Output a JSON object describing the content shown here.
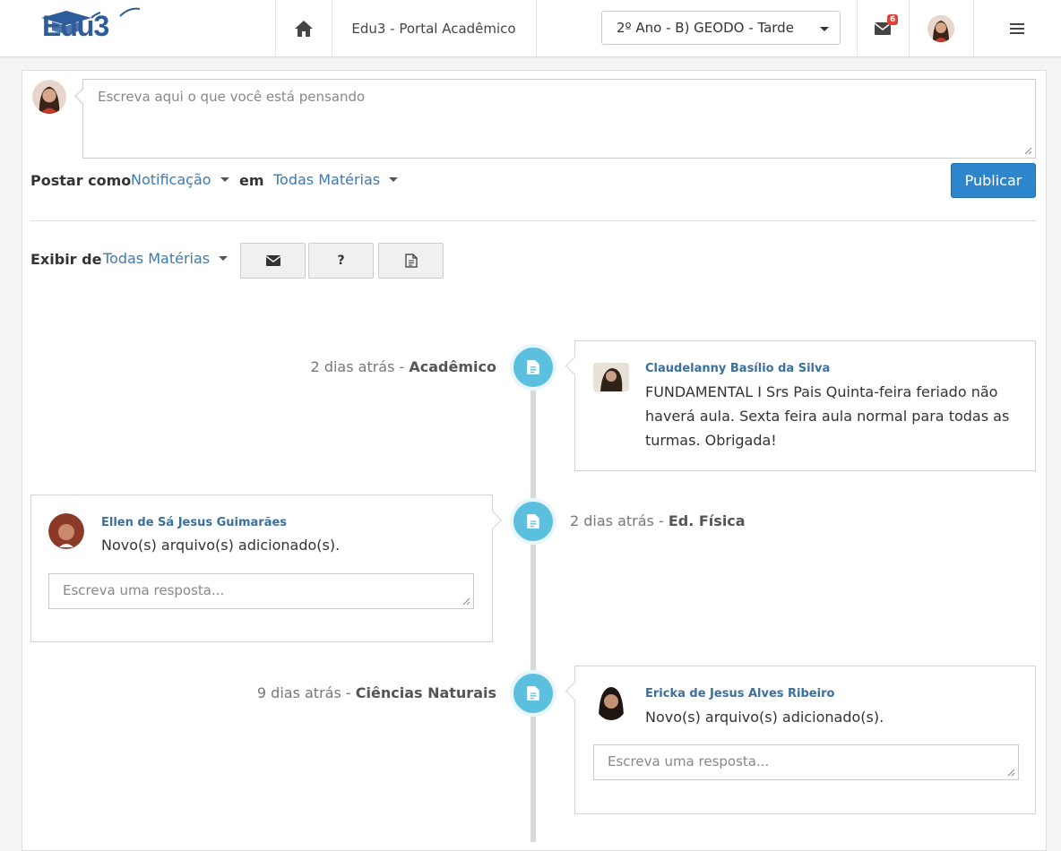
{
  "header": {
    "brand": "Edu3",
    "portal_title": "Edu3 - Portal Acadêmico",
    "class_selector": "2º Ano - B) GEODO - Tarde",
    "mail_badge": "6"
  },
  "composer": {
    "placeholder": "Escreva aqui o que você está pensando",
    "post_as_label": "Postar como",
    "post_as_value": "Notificação",
    "in_label": "em",
    "subject_value": "Todas Matérias",
    "publish_label": "Publicar"
  },
  "filters": {
    "show_label": "Exibir de",
    "show_value": "Todas Matérias",
    "buttons": [
      {
        "icon": "envelope-icon"
      },
      {
        "label": "?"
      },
      {
        "icon": "document-icon"
      }
    ]
  },
  "timeline": [
    {
      "time": "2 dias atrás - ",
      "subject": "Acadêmico",
      "author": "Claudelanny Basílio da Silva",
      "message": "FUNDAMENTAL I Srs Pais Quinta-feira feriado não haverá aula. Sexta feira aula normal para todas as turmas. Obrigada!"
    },
    {
      "time": "2 dias atrás - ",
      "subject": "Ed. Física",
      "author": "Ellen de Sá Jesus Guimarães",
      "message": "Novo(s) arquivo(s) adicionado(s).",
      "reply_placeholder": "Escreva uma resposta..."
    },
    {
      "time": "9 dias atrás - ",
      "subject": "Ciências Naturais",
      "author": "Ericka de Jesus Alves Ribeiro",
      "message": "Novo(s) arquivo(s) adicionado(s).",
      "reply_placeholder": "Escreva uma resposta..."
    }
  ],
  "colors": {
    "accent": "#2d86cb",
    "link": "#3a7ab7",
    "timeline_node": "#5bc0de",
    "badge": "#e0413b"
  }
}
